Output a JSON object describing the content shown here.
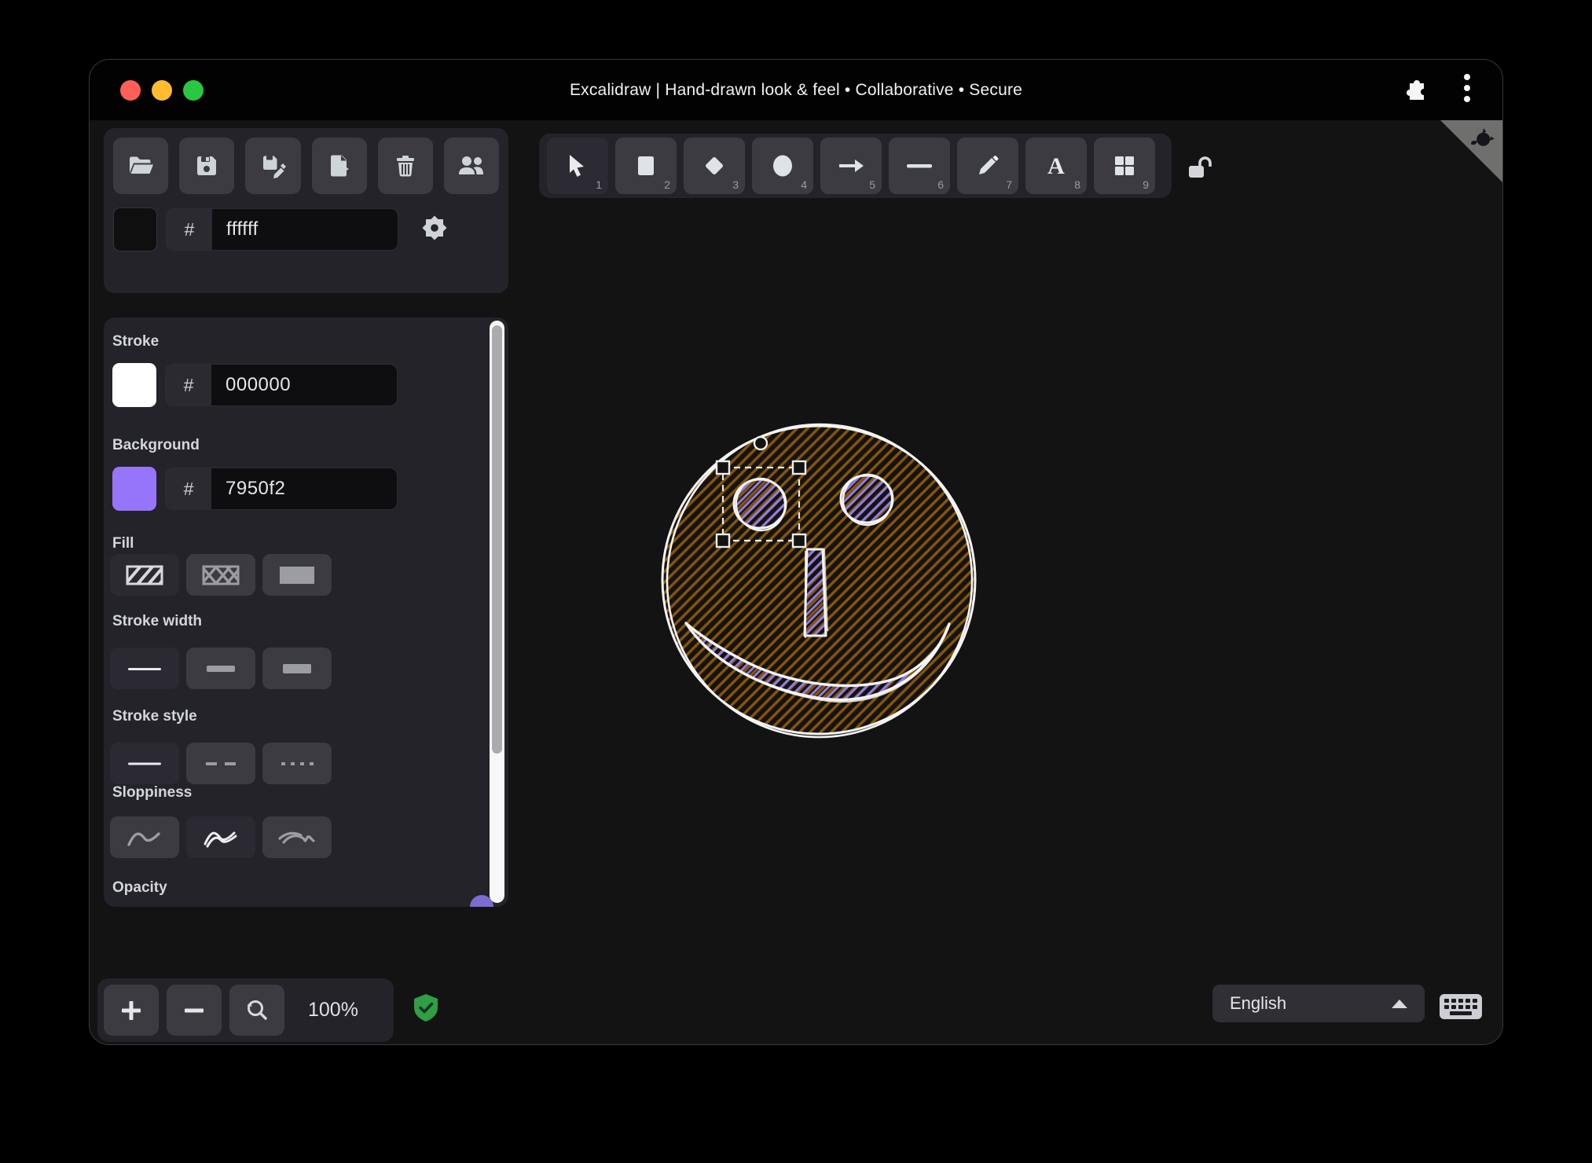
{
  "window": {
    "title": "Excalidraw | Hand-drawn look & feel • Collaborative • Secure"
  },
  "titlebar": {
    "icons": [
      "puzzle-extension-icon",
      "overflow-menu-icon"
    ]
  },
  "menu": {
    "icons": [
      "open-folder",
      "save",
      "save-as",
      "export-file",
      "trash",
      "collaborators"
    ]
  },
  "canvas_background": {
    "hash": "#",
    "value": "ffffff",
    "swatch_color": "#0f0f10"
  },
  "properties": {
    "stroke": {
      "label": "Stroke",
      "hash": "#",
      "value": "000000",
      "swatch_color": "#ffffff"
    },
    "background": {
      "label": "Background",
      "hash": "#",
      "value": "7950f2",
      "swatch_color": "#9775fa"
    },
    "fill": {
      "label": "Fill",
      "options": [
        "hachure",
        "cross-hatch",
        "solid"
      ],
      "selected": "hachure"
    },
    "stroke_width": {
      "label": "Stroke width",
      "options": [
        "thin",
        "bold",
        "extra-bold"
      ],
      "selected": "thin"
    },
    "stroke_style": {
      "label": "Stroke style",
      "options": [
        "solid",
        "dashed",
        "dotted"
      ],
      "selected": "solid"
    },
    "sloppiness": {
      "label": "Sloppiness",
      "options": [
        "architect",
        "artist",
        "cartoonist"
      ],
      "selected": "artist"
    },
    "opacity": {
      "label": "Opacity"
    }
  },
  "tools": [
    {
      "name": "selection",
      "shortcut": "1",
      "active": true
    },
    {
      "name": "rectangle",
      "shortcut": "2",
      "active": false
    },
    {
      "name": "diamond",
      "shortcut": "3",
      "active": false
    },
    {
      "name": "ellipse",
      "shortcut": "4",
      "active": false
    },
    {
      "name": "arrow",
      "shortcut": "5",
      "active": false
    },
    {
      "name": "line",
      "shortcut": "6",
      "active": false
    },
    {
      "name": "draw",
      "shortcut": "7",
      "active": false
    },
    {
      "name": "text",
      "shortcut": "8",
      "active": false
    },
    {
      "name": "library",
      "shortcut": "9",
      "active": false
    }
  ],
  "canvas_lock": "unlocked",
  "footer": {
    "zoom": "100%",
    "language": "English"
  },
  "colors": {
    "traffic_red": "#ff5f57",
    "traffic_yellow": "#febc2e",
    "traffic_green": "#28c840",
    "accent_purple": "#7c6bd0",
    "shield_green": "#2f9e44",
    "hachure_brown": "#8a5504",
    "hachure_purple": "#8f7ce8",
    "selection_stroke": "#ededed"
  }
}
